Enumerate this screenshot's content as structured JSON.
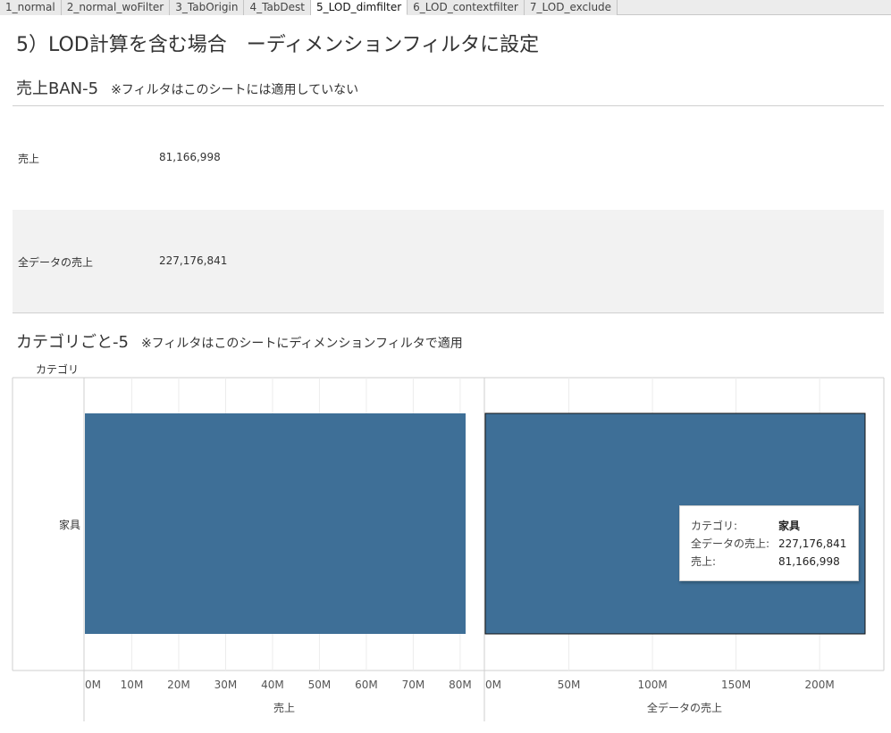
{
  "tabs": [
    {
      "label": "1_normal",
      "active": false
    },
    {
      "label": "2_normal_woFilter",
      "active": false
    },
    {
      "label": "3_TabOrigin",
      "active": false
    },
    {
      "label": "4_TabDest",
      "active": false
    },
    {
      "label": "5_LOD_dimfilter",
      "active": true
    },
    {
      "label": "6_LOD_contextfilter",
      "active": false
    },
    {
      "label": "7_LOD_exclude",
      "active": false
    }
  ],
  "page_title": "5）LOD計算を含む場合　ーディメンションフィルタに設定",
  "sheet1": {
    "title": "売上BAN-5",
    "note": "※フィルタはこのシートには適用していない",
    "rows": [
      {
        "label": "売上",
        "value": "81,166,998"
      },
      {
        "label": "全データの売上",
        "value": "227,176,841"
      }
    ]
  },
  "sheet2": {
    "title": "カテゴリごと-5",
    "note": "※フィルタはこのシートにディメンションフィルタで適用",
    "dimension_header": "カテゴリ",
    "category": "家具"
  },
  "chart_data": [
    {
      "type": "bar",
      "orientation": "horizontal",
      "categories": [
        "家具"
      ],
      "values": [
        81166998
      ],
      "xlabel": "売上",
      "ticks": [
        "0M",
        "10M",
        "20M",
        "30M",
        "40M",
        "50M",
        "60M",
        "70M",
        "80M"
      ],
      "xlim": [
        0,
        82000000
      ],
      "color": "#3e6f97"
    },
    {
      "type": "bar",
      "orientation": "horizontal",
      "categories": [
        "家具"
      ],
      "values": [
        227176841
      ],
      "xlabel": "全データの売上",
      "ticks": [
        "0M",
        "50M",
        "100M",
        "150M",
        "200M"
      ],
      "xlim": [
        0,
        225000000
      ],
      "color": "#3e6f97",
      "selected": true
    }
  ],
  "tooltip": {
    "rows": [
      {
        "key": "カテゴリ:",
        "value": "家具",
        "bold": true
      },
      {
        "key": "全データの売上:",
        "value": "227,176,841",
        "bold": false
      },
      {
        "key": "売上:",
        "value": "81,166,998",
        "bold": false
      }
    ]
  }
}
